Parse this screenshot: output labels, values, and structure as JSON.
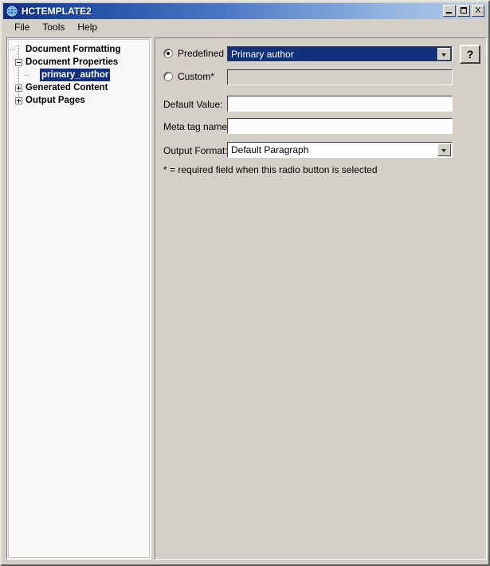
{
  "window": {
    "title": "HCTEMPLATE2",
    "icon": "application-globe-icon",
    "controls": {
      "minimize": "_",
      "maximize": "□",
      "close": "X"
    }
  },
  "menu": {
    "items": [
      {
        "label": "File"
      },
      {
        "label": "Tools"
      },
      {
        "label": "Help"
      }
    ]
  },
  "tree": {
    "nodes": [
      {
        "label": "Document Formatting",
        "level": 0,
        "expander": "none",
        "selected": false
      },
      {
        "label": "Document Properties",
        "level": 0,
        "expander": "minus",
        "selected": false
      },
      {
        "label": "primary_author",
        "level": 1,
        "expander": "none",
        "selected": true
      },
      {
        "label": "Generated Content",
        "level": 0,
        "expander": "plus",
        "selected": false
      },
      {
        "label": "Output Pages",
        "level": 0,
        "expander": "plus",
        "selected": false
      }
    ]
  },
  "form": {
    "predefined": {
      "label": "Predefined",
      "checked": true,
      "combo_value": "Primary author"
    },
    "custom": {
      "label": "Custom*",
      "checked": false,
      "value": "",
      "disabled": true
    },
    "default_value": {
      "label": "Default Value:",
      "value": ""
    },
    "meta_tag_name": {
      "label": "Meta tag name:",
      "value": ""
    },
    "output_format": {
      "label": "Output Format:",
      "value": "Default Paragraph"
    },
    "help_button": {
      "label": "?"
    },
    "note": "* = required field when this radio button is selected"
  },
  "colors": {
    "title_start": "#11317e",
    "title_end": "#b6cdec",
    "selection": "#12307e",
    "face": "#d4d0c8"
  }
}
